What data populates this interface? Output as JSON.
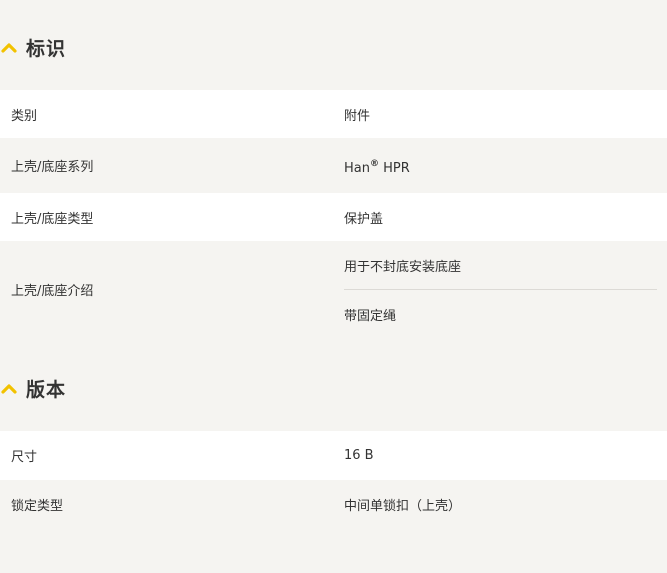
{
  "sections": [
    {
      "title": "标识",
      "rows": [
        {
          "label": "类别",
          "value": "附件"
        },
        {
          "label": "上壳/底座系列",
          "value": "Han",
          "value_sup": "®",
          "value_suffix": " HPR"
        },
        {
          "label": "上壳/底座类型",
          "value": "保护盖"
        },
        {
          "label": "上壳/底座介绍",
          "values": [
            "用于不封底安装底座",
            "带固定绳"
          ]
        }
      ]
    },
    {
      "title": "版本",
      "rows": [
        {
          "label": "尺寸",
          "value": "16 B"
        },
        {
          "label": "锁定类型",
          "value": "中间单锁扣（上壳）"
        }
      ]
    }
  ],
  "colors": {
    "accent": "#f2c200",
    "background": "#f5f4f1",
    "row_white": "#ffffff"
  },
  "icons": {
    "section_toggle": "chevron-up-icon"
  }
}
